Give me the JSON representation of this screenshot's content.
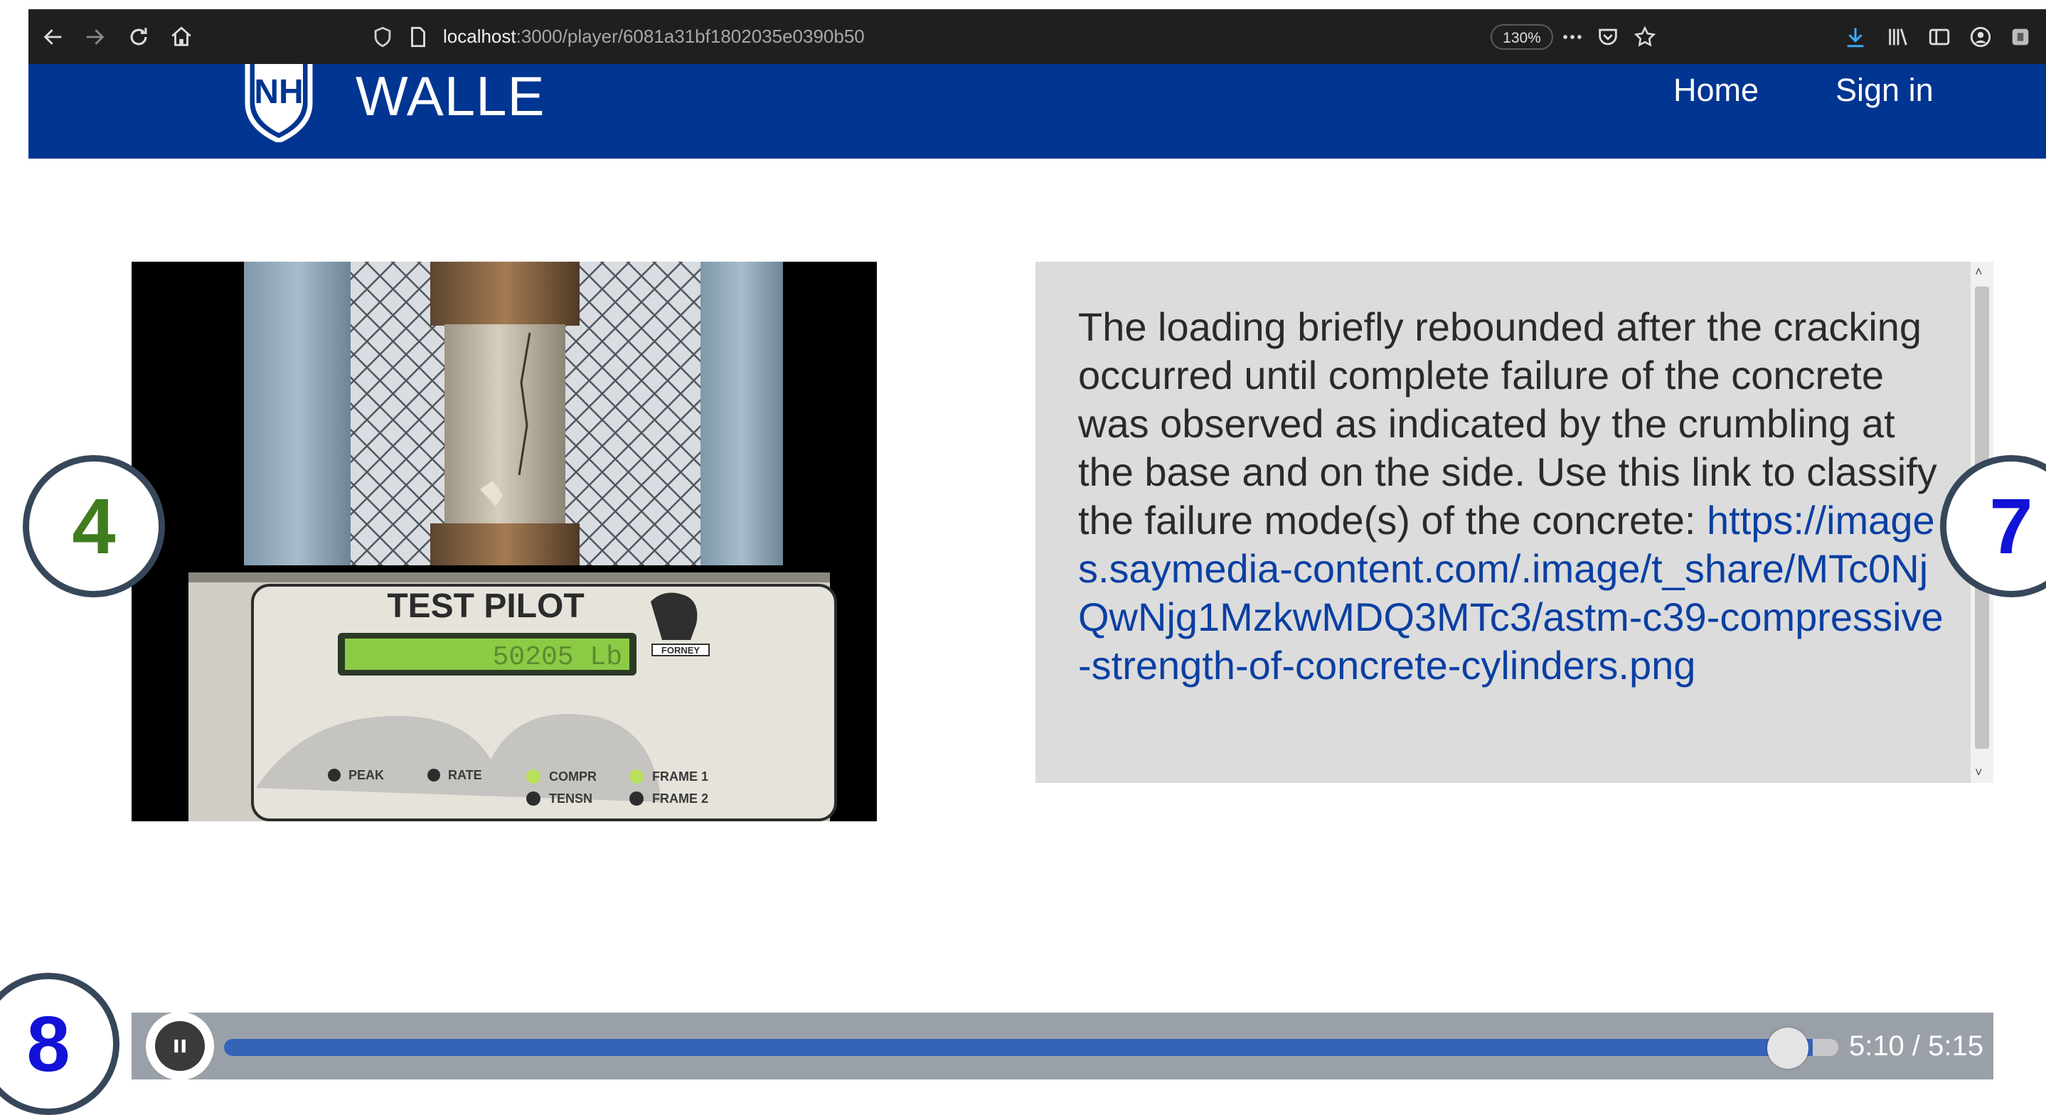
{
  "browser": {
    "url_host": "localhost",
    "url_path": ":3000/player/6081a31bf1802035e0390b50",
    "zoom": "130%"
  },
  "header": {
    "logo_text": "NH",
    "title": "WALLE",
    "nav": {
      "home": "Home",
      "sign_in": "Sign in"
    },
    "bg_color": "#003591"
  },
  "video": {
    "machine_label": "TEST PILOT",
    "display_reading": "50205 Lb",
    "brand": "FORNEY",
    "indicators": [
      "PEAK",
      "RATE",
      "COMPR",
      "TENSN",
      "FRAME 1",
      "FRAME 2"
    ]
  },
  "caption": {
    "text": "The loading briefly rebounded after the cracking occurred until complete failure of the concrete was observed as indicated by the crumbling at the base and on the side. Use this link to classify the failure mode(s) of the concrete: ",
    "link": "https://images.saymedia-content.com/.image/t_share/MTc0NjQwNjg1MzkwMDQ3MTc3/astm-c39-compressive-strength-of-concrete-cylinders.png"
  },
  "markers": {
    "left": {
      "label": "4",
      "color": "#3f7d1f"
    },
    "right": {
      "label": "7",
      "color": "#1212d8"
    },
    "bottom": {
      "label": "8",
      "color": "#1212d8"
    }
  },
  "player": {
    "time": "5:10 / 5:15",
    "progress": 0.984,
    "state": "playing"
  }
}
